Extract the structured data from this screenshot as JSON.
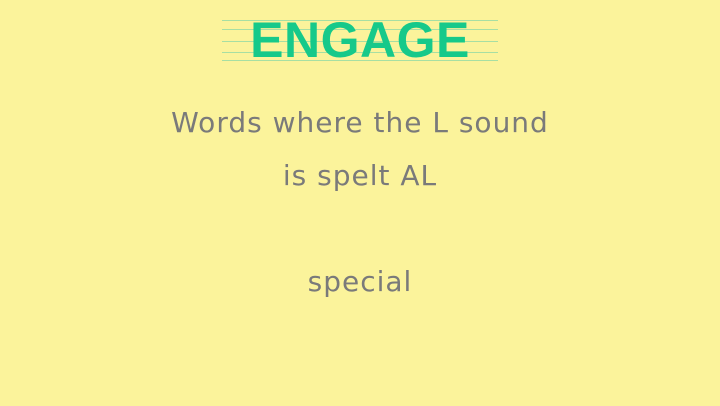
{
  "title": "ENGAGE",
  "heading": {
    "line1": "Words where the L sound",
    "line2": "is spelt AL"
  },
  "example_word": "special",
  "colors": {
    "background": "#fbf39b",
    "title": "#16c98a",
    "guide_lines": "#a7dfa3",
    "text": "#7a7a7a"
  }
}
